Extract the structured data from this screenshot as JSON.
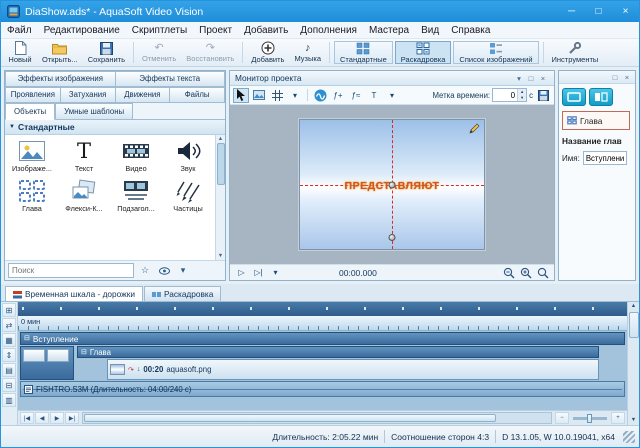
{
  "window": {
    "title": "DiaShow.ads* - AquaSoft Video Vision"
  },
  "icons": {
    "minimize": "─",
    "maximize": "□",
    "close": "×",
    "dropdown": "▾",
    "collapse": "⊟",
    "play": "▷",
    "play_from": "▷|",
    "skip_start": "|◀",
    "step_back": "◀",
    "step_fwd": "▶",
    "skip_end": "▶|",
    "zoom_out": "−",
    "zoom_in": "+",
    "star": "☆",
    "undo": "↶",
    "redo": "↷",
    "fx_add": "ƒ+",
    "fx_wave": "ƒ≈",
    "text_tool": "T",
    "transition": "↷",
    "motion": "↓",
    "scroll_up": "▲",
    "scroll_down": "▼",
    "tools": [
      "⊞",
      "⇄",
      "▦",
      "⇕",
      "▤",
      "⊟",
      "▥"
    ]
  },
  "menu": [
    "Файл",
    "Редактирование",
    "Скриптлеты",
    "Проект",
    "Добавить",
    "Дополнения",
    "Мастера",
    "Вид",
    "Справка"
  ],
  "toolbar": {
    "new": "Новый",
    "open": "Открыть...",
    "save": "Сохранить",
    "undo": "Отменить",
    "redo": "Восстановить",
    "add": "Добавить",
    "music": "Музыка",
    "standard": "Стандартные",
    "storyboard": "Раскадровка",
    "image_list": "Список изображений",
    "tools": "Инструменты"
  },
  "left_panel": {
    "tabs1": [
      "Эффекты изображения",
      "Эффекты текста"
    ],
    "tabs2": [
      "Проявления",
      "Затухания",
      "Движения",
      "Файлы"
    ],
    "tabs3": [
      "Объекты",
      "Умные шаблоны"
    ],
    "section": "Стандартные",
    "items": [
      "Изображе...",
      "Текст",
      "Видео",
      "Звук",
      "Глава",
      "Флекси-К...",
      "Подзагол...",
      "Частицы"
    ],
    "search_placeholder": "Поиск"
  },
  "monitor": {
    "title": "Монитор проекта",
    "time_label": "Метка времени:",
    "time_value": "0",
    "time_unit": "с",
    "preview_text": "ПРЕДСТАВЛЯЮТ",
    "position": "00:00.000"
  },
  "right_panel": {
    "tab": "Глава",
    "heading": "Название глав",
    "name_label": "Имя:",
    "name_value": "Вступление"
  },
  "timeline": {
    "tab_tracks": "Временная шкала - дорожки",
    "tab_storyboard": "Раскадровка",
    "ruler_start": "0 мин",
    "track_intro": "Вступление",
    "track_chapter": "Глава",
    "clip_duration": "00:20",
    "clip_name": "aquasoft.png",
    "audio_clip": "FISHTRO.S3M (Длительность: 04:00/240 с)"
  },
  "statusbar": {
    "duration": "Длительность: 2:05.22 мин",
    "aspect": "Соотношение сторон 4:3",
    "system": "D 13.1.05, W 10.0.19041, x64"
  }
}
